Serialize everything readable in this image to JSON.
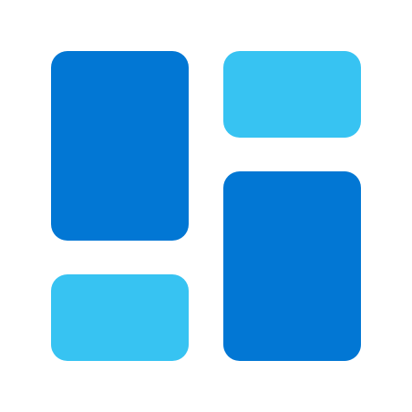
{
  "icon": {
    "name": "dashboard-layout-icon",
    "colors": {
      "dark_blue": "#0277d4",
      "light_blue": "#37c3f2",
      "background": "#ffffff"
    },
    "tiles": [
      {
        "name": "tile-top-left",
        "color": "dark_blue"
      },
      {
        "name": "tile-top-right",
        "color": "light_blue"
      },
      {
        "name": "tile-bottom-left",
        "color": "light_blue"
      },
      {
        "name": "tile-bottom-right",
        "color": "dark_blue"
      }
    ]
  }
}
